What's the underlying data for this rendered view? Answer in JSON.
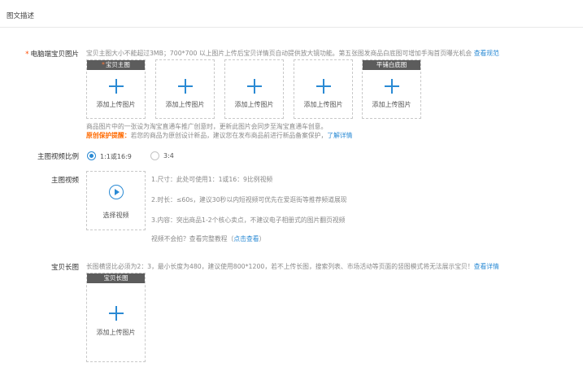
{
  "section": {
    "title": "图文描述"
  },
  "pc_images": {
    "label": "电脑端宝贝图片",
    "hint": "宝贝主图大小不能超过3MB；700*700 以上图片上传后宝贝详情页自动提供放大镜功能。第五张图发商品白底图可增加手淘首页曝光机会",
    "hint_link": "查看规范",
    "slots": [
      {
        "tag": "宝贝主图",
        "text": "添加上传图片"
      },
      {
        "tag": "",
        "text": "添加上传图片"
      },
      {
        "tag": "",
        "text": "添加上传图片"
      },
      {
        "tag": "",
        "text": "添加上传图片"
      },
      {
        "tag": "平铺白底图",
        "text": "添加上传图片"
      }
    ],
    "note1": "商品图片中的一张设为淘宝直通车推广创意时，更新此图片会同步至淘宝直通车创意。",
    "note2_warn": "原创保护提醒：",
    "note2": "若您的商品为原创设计新品，建议您在发布商品前进行新品备案保护，",
    "note2_link": "了解详情"
  },
  "video_ratio": {
    "label": "主图视频比例",
    "options": [
      "1:1或16:9",
      "3:4"
    ],
    "selected": "1:1或16:9"
  },
  "main_video": {
    "label": "主图视频",
    "select_text": "选择视频",
    "tips": [
      "1.尺寸：此处可使用1：1或16：9比例视频",
      "2.时长：≤60s，建议30秒以内短视频可优先在爱逛街等推荐频道展现",
      "3.内容：突出商品1-2个核心卖点，不建议电子相册式的图片翻页视频"
    ],
    "help_prefix": "视频不会拍？查看完整教程（",
    "help_link": "点击查看",
    "help_suffix": "）"
  },
  "long_image": {
    "label": "宝贝长图",
    "hint": "长图横竖比必须为2：3，最小长度为480，建议使用800*1200，若不上传长图，搜索列表、市场活动等页面的竖图模式将无法展示宝贝！",
    "hint_link": "查看详情",
    "slot": {
      "tag": "宝贝长图",
      "text": "添加上传图片"
    }
  },
  "colors": {
    "accent": "#2a8ad4",
    "warning": "#ff6a00",
    "required": "#ff4a00",
    "tag_bg": "#5c5c5c"
  }
}
